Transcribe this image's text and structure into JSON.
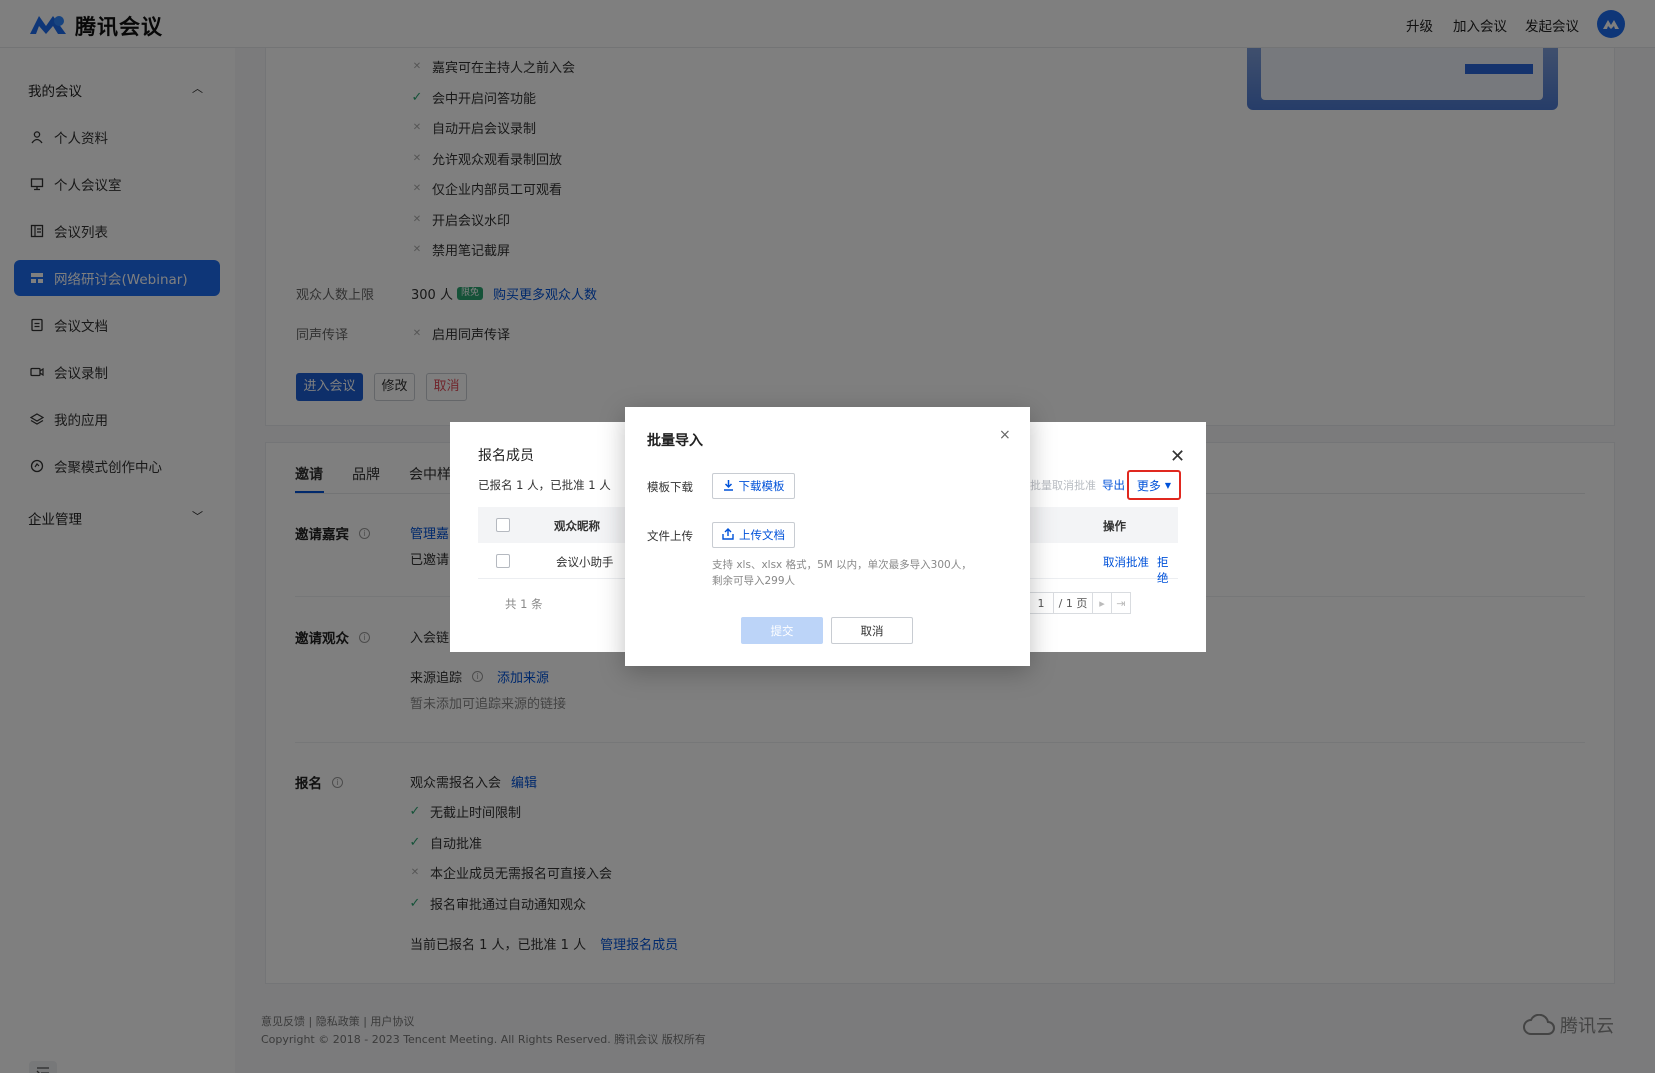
{
  "header": {
    "logo_text": "腾讯会议",
    "nav": [
      "升级",
      "加入会议",
      "发起会议"
    ]
  },
  "sidebar": {
    "my_meetings": "我的会议",
    "items": [
      {
        "label": "个人资料",
        "icon": "user-icon"
      },
      {
        "label": "个人会议室",
        "icon": "monitor-icon"
      },
      {
        "label": "会议列表",
        "icon": "list-icon"
      },
      {
        "label": "网络研讨会(Webinar)",
        "icon": "webinar-icon",
        "active": true
      },
      {
        "label": "会议文档",
        "icon": "document-icon"
      },
      {
        "label": "会议录制",
        "icon": "video-icon"
      },
      {
        "label": "我的应用",
        "icon": "layers-icon"
      },
      {
        "label": "会聚模式创作中心",
        "icon": "creation-icon"
      }
    ],
    "enterprise": "企业管理"
  },
  "settings": {
    "options": [
      {
        "label": "嘉宾可在主持人之前入会",
        "enabled": false
      },
      {
        "label": "会中开启问答功能",
        "enabled": true
      },
      {
        "label": "自动开启会议录制",
        "enabled": false
      },
      {
        "label": "允许观众观看录制回放",
        "enabled": false
      },
      {
        "label": "仅企业内部员工可观看",
        "enabled": false
      },
      {
        "label": "开启会议水印",
        "enabled": false
      },
      {
        "label": "禁用笔记截屏",
        "enabled": false
      }
    ],
    "audience_limit_label": "观众人数上限",
    "audience_limit_value": "300 人",
    "audience_badge": "限免",
    "buy_more": "购买更多观众人数",
    "interpretation_label": "同声传译",
    "interpretation_value": "启用同声传译",
    "btn_enter": "进入会议",
    "btn_edit": "修改",
    "btn_cancel": "取消"
  },
  "tabs": [
    "邀请",
    "品牌",
    "会中样"
  ],
  "invite": {
    "guests_title": "邀请嘉宾",
    "guests_link": "管理嘉",
    "guests_status": "已邀请",
    "audience_title": "邀请观众",
    "audience_link_label": "入会链",
    "source_label": "来源追踪",
    "add_source": "添加来源",
    "no_source": "暂未添加可追踪来源的链接",
    "signup_title": "报名",
    "signup_required": "观众需报名入会",
    "edit": "编辑",
    "signup_options": [
      {
        "label": "无截止时间限制",
        "enabled": true
      },
      {
        "label": "自动批准",
        "enabled": true
      },
      {
        "label": "本企业成员无需报名可直接入会",
        "enabled": false
      },
      {
        "label": "报名审批通过自动通知观众",
        "enabled": true
      }
    ],
    "signup_summary": "当前已报名 1 人，已批准 1 人",
    "manage_members": "管理报名成员"
  },
  "footer": {
    "links": "意见反馈 | 隐私政策 | 用户协议",
    "copyright": "Copyright © 2018 - 2023 Tencent Meeting. All Rights Reserved. 腾讯会议 版权所有",
    "brand": "腾讯云"
  },
  "members_modal": {
    "title": "报名成员",
    "summary": "已报名 1 人，已批准 1 人",
    "toolbar_faded": "批量取消批准",
    "export": "导出",
    "more": "更多",
    "col_nickname": "观众昵称",
    "col_actions": "操作",
    "row_nickname": "会议小助手",
    "row_action_revoke": "取消批准",
    "row_action_reject": "拒绝",
    "total": "共 1 条",
    "page_current": "1",
    "page_total": "/ 1 页"
  },
  "import_dialog": {
    "title": "批量导入",
    "template_label": "模板下载",
    "template_button": "下载模板",
    "upload_label": "文件上传",
    "upload_button": "上传文档",
    "hint_line1": "支持 xls、xlsx 格式，5M 以内，单次最多导入300人，",
    "hint_line2": "剩余可导入299人",
    "submit": "提交",
    "cancel": "取消"
  },
  "colors": {
    "accent": "#1c6cf0",
    "primary_button": "#1c5fd4",
    "success": "#2ba471",
    "danger": "#e34d59",
    "highlight": "#e0281f"
  }
}
